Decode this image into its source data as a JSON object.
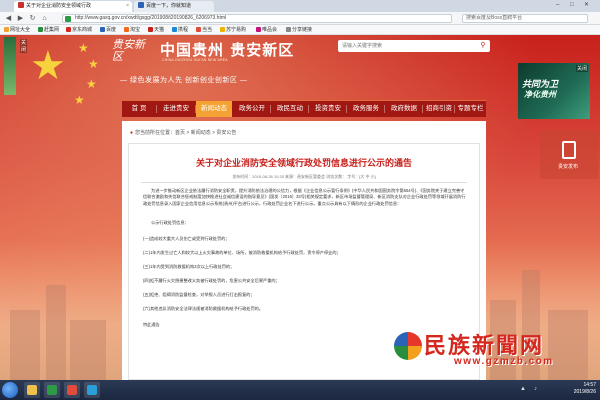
{
  "browser": {
    "tabs": [
      {
        "label": "关于对企业消防安全领域行政",
        "active": true
      },
      {
        "label": "百度一下，你就知道",
        "active": false
      }
    ],
    "url": "http://www.gaxq.gov.cn/xwdt/gsgg/201908/t20190826_6206973.html",
    "search_text": "搜索百度及Boss直聘平台",
    "bookmarks": [
      "网址大全",
      "赶集网",
      "京东商城",
      "百度",
      "淘宝",
      "天猫",
      "携程",
      "当当",
      "苏宁易购",
      "唯品会",
      "分享链接"
    ]
  },
  "site": {
    "logo_mark": "贵安新区",
    "title": "中国贵州 贵安新区",
    "subtitle": "CHINA GUIZHOU GUI'AN NEW AREA",
    "slogan": "— 绿色发展为人先  创新创业创新区 —",
    "search_placeholder": "请输入关键字搜索"
  },
  "ads": {
    "right_t1": "共同为卫",
    "right_t2": "净化贵州",
    "right2_label": "贵安发布",
    "close": "关闭"
  },
  "nav": {
    "items": [
      {
        "label": "首 页",
        "active": false
      },
      {
        "label": "走进贵安",
        "active": false
      },
      {
        "label": "新闻动态",
        "active": true
      },
      {
        "label": "政务公开",
        "active": false
      },
      {
        "label": "政民互动",
        "active": false
      },
      {
        "label": "投资贵安",
        "active": false
      },
      {
        "label": "政务服务",
        "active": false
      },
      {
        "label": "政府数据",
        "active": false
      },
      {
        "label": "招商引资",
        "active": false
      },
      {
        "label": "专题专栏",
        "active": false
      }
    ]
  },
  "breadcrumb": "您当前所在位置：首页 > 新闻动态 > 贵安公告",
  "article": {
    "title": "关于对企业消防安全领域行政处罚信息进行公示的通告",
    "meta": "发布时间：2019-08-26 10:33   来源：贵安新区管委会   浏览次数：  字号：[大 中 小]",
    "p1": "为进一步推动新区企业依法履行消防安全职责，提升消防依法治理的公信力，根据《企业信息公示暂行条例》(中华人民共和国国务院令第654号)、《国务院关于建立完善守信联合激励和失信联合惩戒制度加快推进社会诚信建设的指导意见》(国发〔2016〕33号)相关规定要求，新区市场监督管理局、新区消防支队对企业行政处罚等领域开展消防行政处罚信息录入国家企业信用信息公示系统(贵州)平台进行公示，行政处罚企业名下进行公示。重点公示具有以下情形的企业行政处罚信息：",
    "p2": "公示行政处罚信息：",
    "items": [
      "(一)造成较大重大人员伤亡或受到行政处罚的；",
      "(二)1年内发生过亡人和较大以上火灾事故的单位、场所，被消防救援机构给予行政处罚，责令停产停业的；",
      "(三)1年内受到消防救援机构3次以上行政处罚的；",
      "(四)拒不履行火灾隐患整改义务被行政处罚的，危害公共安全后果严重的；",
      "(五)拒绝、阻碍消防监督检查，对举报人员进行打击报复的；",
      "(六)其他违反消防安全法律法规被消防救援机构给予行政处罚的。"
    ],
    "ending": "特此通告"
  },
  "watermark": {
    "name": "民族新聞网",
    "url": "www.gzmzb.com"
  },
  "taskbar": {
    "time": "14:57",
    "date": "2019/8/26"
  },
  "colors": {
    "brand_red": "#c8211c",
    "nav_active": "#f3a233",
    "nav_bg": "#a11813"
  }
}
